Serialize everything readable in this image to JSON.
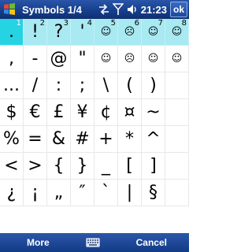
{
  "title": "Symbols 1/4",
  "time": "21:23",
  "ok_label": "ok",
  "icons": {
    "start": "windows-flag-icon",
    "connectivity": "data-arrows-icon",
    "signal": "signal-strength-icon",
    "volume": "speaker-icon"
  },
  "grid": [
    [
      {
        "g": ".",
        "n": "1",
        "hl": true,
        "sel": true
      },
      {
        "g": "!",
        "n": "2",
        "hl": true
      },
      {
        "g": "?",
        "n": "3",
        "hl": true
      },
      {
        "g": "'",
        "n": "4",
        "hl": true
      },
      {
        "g": "☺",
        "n": "5",
        "hl": true,
        "smiley": true
      },
      {
        "g": "☹",
        "n": "6",
        "hl": true,
        "smiley": true
      },
      {
        "g": "☺",
        "n": "7",
        "hl": true,
        "smiley": true
      },
      {
        "g": "☺",
        "n": "8",
        "hl": true,
        "smiley": true
      }
    ],
    [
      {
        "g": ","
      },
      {
        "g": "-"
      },
      {
        "g": "@"
      },
      {
        "g": "\""
      },
      {
        "g": "☺",
        "smiley": true
      },
      {
        "g": "☹",
        "smiley": true
      },
      {
        "g": "☺",
        "smiley": true
      },
      {
        "g": "☺",
        "smiley": true
      }
    ],
    [
      {
        "g": "..."
      },
      {
        "g": "/"
      },
      {
        "g": ":"
      },
      {
        "g": ";"
      },
      {
        "g": "\\"
      },
      {
        "g": "("
      },
      {
        "g": ")"
      },
      {
        "g": ""
      }
    ],
    [
      {
        "g": "$"
      },
      {
        "g": "€"
      },
      {
        "g": "£"
      },
      {
        "g": "¥"
      },
      {
        "g": "¢"
      },
      {
        "g": "¤"
      },
      {
        "g": "~"
      },
      {
        "g": ""
      }
    ],
    [
      {
        "g": "%"
      },
      {
        "g": "="
      },
      {
        "g": "&"
      },
      {
        "g": "#"
      },
      {
        "g": "+"
      },
      {
        "g": "*"
      },
      {
        "g": "^"
      },
      {
        "g": ""
      }
    ],
    [
      {
        "g": "<"
      },
      {
        "g": ">"
      },
      {
        "g": "{"
      },
      {
        "g": "}"
      },
      {
        "g": "_"
      },
      {
        "g": "["
      },
      {
        "g": "]"
      },
      {
        "g": ""
      }
    ],
    [
      {
        "g": "¿"
      },
      {
        "g": "¡"
      },
      {
        "g": "„"
      },
      {
        "g": "″"
      },
      {
        "g": "`"
      },
      {
        "g": "|"
      },
      {
        "g": "§"
      },
      {
        "g": ""
      }
    ]
  ],
  "menu": {
    "left": "More",
    "right": "Cancel",
    "keyboard_icon": "keyboard-icon"
  },
  "colors": {
    "titlebar": "#153d8a",
    "highlight_row": "#a9e9f1",
    "selected_cell": "#25d3e2"
  }
}
